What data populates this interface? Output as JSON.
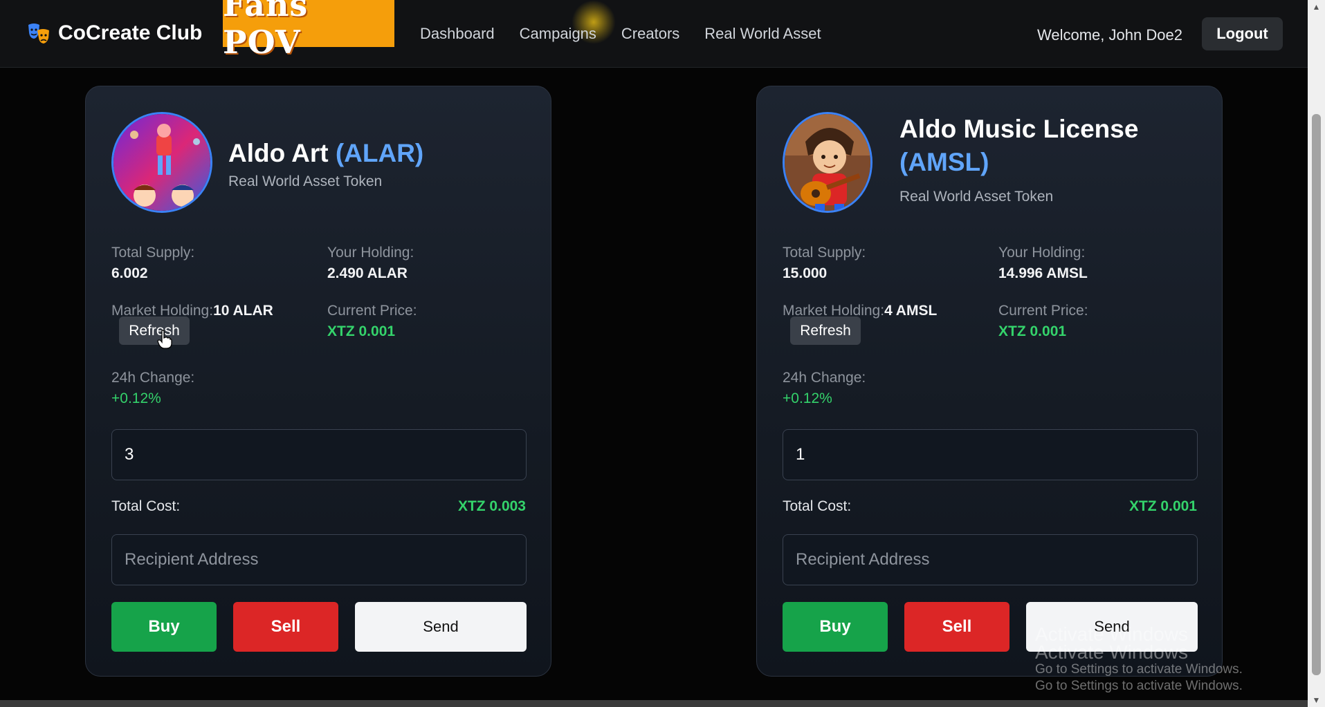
{
  "nav": {
    "brand": "CoCreate Club",
    "badge": "Fans POV",
    "links": [
      "Dashboard",
      "Campaigns",
      "Creators",
      "Real World Asset"
    ],
    "welcome": "Welcome, John Doe2",
    "logout": "Logout"
  },
  "cards": [
    {
      "name": "Aldo Art",
      "symbol": "(ALAR)",
      "subtitle": "Real World Asset Token",
      "total_supply_label": "Total Supply:",
      "total_supply": "6.002",
      "your_holding_label": "Your Holding:",
      "your_holding": "2.490 ALAR",
      "market_holding_label": "Market Holding:",
      "market_holding": "10 ALAR",
      "refresh": "Refresh",
      "current_price_label": "Current Price:",
      "current_price": "XTZ 0.001",
      "change_label": "24h Change:",
      "change": "+0.12%",
      "amount": "3",
      "total_cost_label": "Total Cost:",
      "total_cost": "XTZ 0.003",
      "recipient_placeholder": "Recipient Address",
      "buy": "Buy",
      "sell": "Sell",
      "send": "Send"
    },
    {
      "name": "Aldo Music License",
      "symbol": "(AMSL)",
      "subtitle": "Real World Asset Token",
      "total_supply_label": "Total Supply:",
      "total_supply": "15.000",
      "your_holding_label": "Your Holding:",
      "your_holding": "14.996 AMSL",
      "market_holding_label": "Market Holding:",
      "market_holding": "4 AMSL",
      "refresh": "Refresh",
      "current_price_label": "Current Price:",
      "current_price": "XTZ 0.001",
      "change_label": "24h Change:",
      "change": "+0.12%",
      "amount": "1",
      "total_cost_label": "Total Cost:",
      "total_cost": "XTZ 0.001",
      "recipient_placeholder": "Recipient Address",
      "buy": "Buy",
      "sell": "Sell",
      "send": "Send"
    }
  ],
  "watermark": {
    "line1": "Activate Windows",
    "line2": "Activate Windows",
    "line3": "Go to Settings to activate Windows.",
    "line4": "Go to Settings to activate Windows."
  },
  "colors": {
    "accent_blue": "#60a5fa",
    "positive_green": "#34d36b",
    "buy_green": "#16a34a",
    "sell_red": "#dc2626",
    "badge_orange": "#f59e0b"
  },
  "icons": {
    "brand": "masks-icon",
    "cursor": "hand-pointer-icon"
  }
}
